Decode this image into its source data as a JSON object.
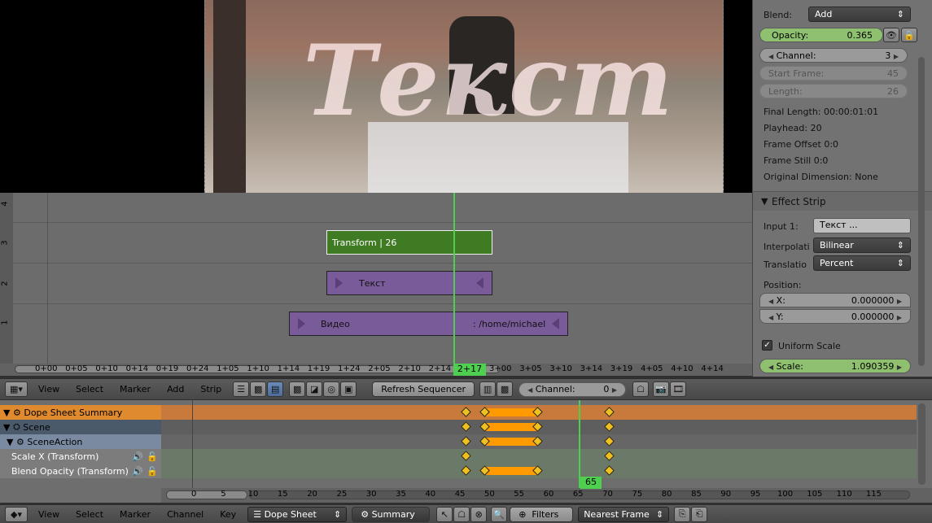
{
  "preview": {
    "overlay_text": "Текст"
  },
  "properties": {
    "blend_label": "Blend:",
    "blend_value": "Add",
    "opacity_label": "Opacity:",
    "opacity_value": "0.365",
    "opacity_fraction": 0.365,
    "channel_label": "Channel:",
    "channel_value": "3",
    "start_frame_label": "Start Frame:",
    "start_frame_value": "45",
    "length_label": "Length:",
    "length_value": "26",
    "final_length": "Final Length: 00:00:01:01",
    "playhead": "Playhead: 20",
    "frame_offset": "Frame Offset 0:0",
    "frame_still": "Frame Still 0:0",
    "original_dimension": "Original Dimension: None",
    "effect_strip_title": "Effect Strip",
    "input1_label": "Input 1:",
    "input1_value": "Текст      ...",
    "interpolation_label": "Interpolati",
    "interpolation_value": "Bilinear",
    "translation_label": "Translatio",
    "translation_value": "Percent",
    "position_label": "Position:",
    "x_label": "X:",
    "x_value": "0.000000",
    "y_label": "Y:",
    "y_value": "0.000000",
    "uniform_scale_label": "Uniform Scale",
    "scale_label": "Scale:",
    "scale_value": "1.090359"
  },
  "sequencer": {
    "channels": [
      "4",
      "3",
      "2",
      "1"
    ],
    "strips": {
      "transform": "Transform | 26",
      "text": "Текст",
      "video_name": "Видео",
      "video_path": ": /home/michael"
    },
    "playhead_label": "2+17",
    "ruler": [
      "0+00",
      "0+05",
      "0+10",
      "0+14",
      "0+19",
      "0+24",
      "1+05",
      "1+10",
      "1+14",
      "1+19",
      "1+24",
      "2+05",
      "2+10",
      "2+14",
      "2+19",
      "3+00",
      "3+05",
      "3+10",
      "3+14",
      "3+19",
      "4+05",
      "4+10",
      "4+14"
    ]
  },
  "seq_header": {
    "menus": [
      "View",
      "Select",
      "Marker",
      "Add",
      "Strip"
    ],
    "refresh": "Refresh Sequencer",
    "channel_label": "Channel:",
    "channel_value": "0"
  },
  "dopesheet": {
    "rows": [
      {
        "label": "Dope Sheet Summary"
      },
      {
        "label": "Scene"
      },
      {
        "label": "SceneAction"
      },
      {
        "label": "Scale X (Transform)"
      },
      {
        "label": "Blend Opacity (Transform)"
      }
    ],
    "playhead_label": "65",
    "ruler": [
      "0",
      "5",
      "10",
      "15",
      "20",
      "25",
      "30",
      "35",
      "40",
      "45",
      "50",
      "55",
      "60",
      "65",
      "70",
      "75",
      "80",
      "85",
      "90",
      "95",
      "100",
      "105",
      "110",
      "115"
    ]
  },
  "dope_header": {
    "menus": [
      "View",
      "Select",
      "Marker",
      "Channel",
      "Key"
    ],
    "mode": "Dope Sheet",
    "summary": "Summary",
    "filters": "Filters",
    "snap": "Nearest Frame"
  },
  "colors": {
    "accent": "#4fcf50",
    "orange": "#ff9a00",
    "keyframe": "#f0c020"
  }
}
